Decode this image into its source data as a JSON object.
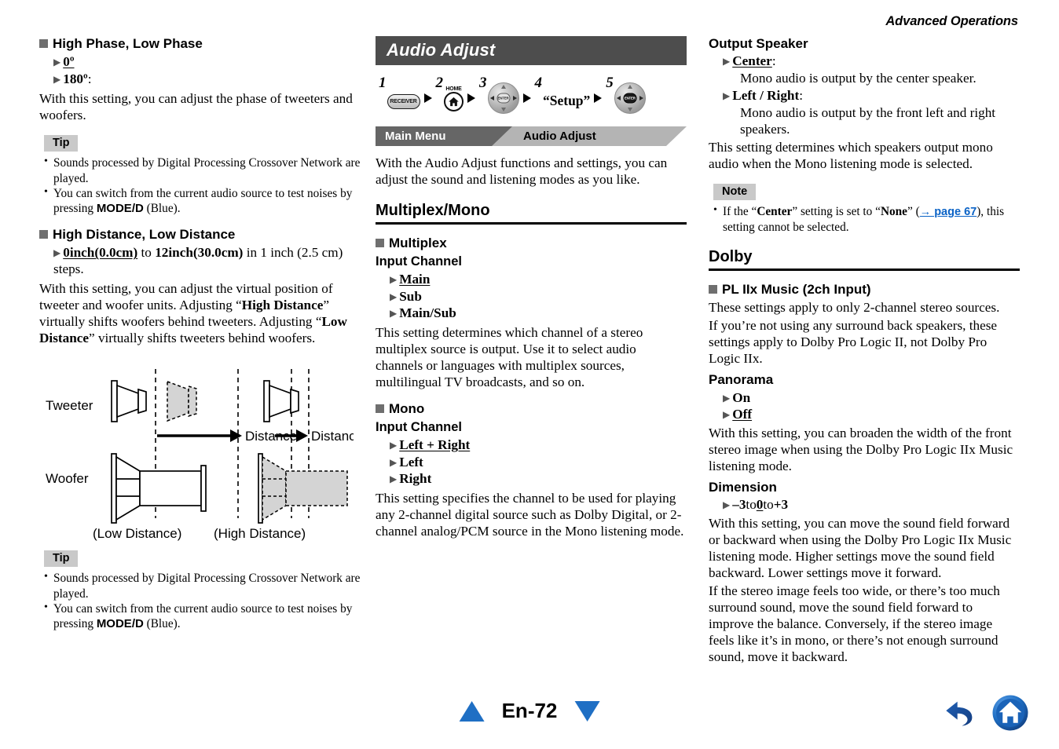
{
  "running_head": "Advanced Operations",
  "left_column": {
    "section1": {
      "heading": "High Phase, Low Phase",
      "options": [
        {
          "label": "0º",
          "underlined": true,
          "suffix": ""
        },
        {
          "label": "180º",
          "underlined": false,
          "suffix": ":"
        }
      ],
      "body": "With this setting, you can adjust the phase of tweeters and woofers.",
      "tip_label": "Tip",
      "tips": [
        "Sounds processed by Digital Processing Crossover Network are played.",
        "You can switch from the current audio source to test noises by pressing MODE/D (Blue)."
      ],
      "tip2_prefix": "You can switch from the current audio source to test noises by pressing ",
      "tip2_key": "MODE/D",
      "tip2_suffix": " (Blue)."
    },
    "section2": {
      "heading": "High Distance, Low Distance",
      "range_from": "0inch(0.0cm)",
      "range_mid": " to ",
      "range_to": "12inch(30.0cm)",
      "range_tail": " in 1 inch (2.5 cm) steps.",
      "body_1": "With this setting, you can adjust the virtual position of tweeter and woofer units. Adjusting “",
      "body_b1": "High Distance",
      "body_2": "” virtually shifts woofers behind tweeters. Adjusting “",
      "body_b2": "Low Distance",
      "body_3": "” virtually shifts tweeters behind woofers.",
      "tip_label": "Tip",
      "tip1": "Sounds processed by Digital Processing Crossover Network are played.",
      "tip2_prefix": "You can switch from the current audio source to test noises by pressing ",
      "tip2_key": "MODE/D",
      "tip2_suffix": " (Blue)."
    },
    "diagram": {
      "row_label_top": "Tweeter",
      "row_label_bottom": "Woofer",
      "distance_label_left": "Distance",
      "distance_label_right": "Distance",
      "caption_left": "(Low Distance)",
      "caption_right": "(High Distance)"
    }
  },
  "mid_column": {
    "title": "Audio Adjust",
    "steps": {
      "n1": "1",
      "btn1_label": "RECEIVER",
      "n2": "2",
      "btn2_label": "HOME",
      "btn2_icon": "home-icon",
      "n3": "3",
      "btn3_center": "ENTER",
      "n4": "4",
      "step4_text": "“Setup”",
      "n5": "5",
      "btn5_center": "ENTER"
    },
    "breadcrumb": {
      "parent": "Main Menu",
      "current": "Audio Adjust"
    },
    "intro": "With the Audio Adjust functions and settings, you can adjust the sound and listening modes as you like.",
    "section_heading": "Multiplex/Mono",
    "multiplex": {
      "heading": "Multiplex",
      "sub_head": "Input Channel",
      "options": [
        {
          "label": "Main",
          "underlined": true
        },
        {
          "label": "Sub",
          "underlined": false
        },
        {
          "label": "Main/Sub",
          "underlined": false
        }
      ],
      "body": "This setting determines which channel of a stereo multiplex source is output. Use it to select audio channels or languages with multiplex sources, multilingual TV broadcasts, and so on."
    },
    "mono": {
      "heading": "Mono",
      "sub_head": "Input Channel",
      "options": [
        {
          "label": "Left + Right",
          "underlined": true
        },
        {
          "label": "Left",
          "underlined": false
        },
        {
          "label": "Right",
          "underlined": false
        }
      ],
      "body": "This setting specifies the channel to be used for playing any 2-channel digital source such as Dolby Digital, or 2-channel analog/PCM source in the Mono listening mode."
    }
  },
  "right_column": {
    "output_speaker": {
      "sub_head": "Output Speaker",
      "options": [
        {
          "label": "Center",
          "underlined": true,
          "colon": ":",
          "desc": "Mono audio is output by the center speaker."
        },
        {
          "label": "Left / Right",
          "underlined": false,
          "colon": ":",
          "desc": "Mono audio is output by the front left and right speakers."
        }
      ],
      "body": "This setting determines which speakers output mono audio when the Mono listening mode is selected."
    },
    "note": {
      "label": "Note",
      "part1": "If the “",
      "bold1": "Center",
      "part2": "” setting is set to “",
      "bold2": "None",
      "part3": "” (",
      "link": "→ page 67",
      "part4": "), this setting cannot be selected."
    },
    "dolby": {
      "section_heading": "Dolby",
      "heading": "PL IIx Music (2ch Input)",
      "body1": "These settings apply to only 2-channel stereo sources.",
      "body2": "If you’re not using any surround back speakers, these settings apply to Dolby Pro Logic II, not Dolby Pro Logic IIx.",
      "panorama": {
        "sub_head": "Panorama",
        "options": [
          {
            "label": "On",
            "underlined": false
          },
          {
            "label": "Off",
            "underlined": true
          }
        ],
        "body": "With this setting, you can broaden the width of the front stereo image when using the Dolby Pro Logic IIx Music listening mode."
      },
      "dimension": {
        "sub_head": "Dimension",
        "range_a": "–3",
        "range_sep1": " to ",
        "range_b": "0",
        "range_sep2": " to ",
        "range_c": "+3",
        "body1": "With this setting, you can move the sound field forward or backward when using the Dolby Pro Logic IIx Music listening mode. Higher settings move the sound field backward. Lower settings move it forward.",
        "body2": "If the stereo image feels too wide, or there’s too much surround sound, move the sound field forward to improve the balance. Conversely, if the stereo image feels like it’s in mono, or there’s not enough surround sound, move it backward."
      }
    }
  },
  "footer": {
    "prev_label": "prev-page-triangle",
    "page_number": "En-72",
    "next_label": "next-page-triangle",
    "back_icon": "back-arrow-icon",
    "home_icon": "home-icon"
  },
  "colors": {
    "title_bar": "#4d4d4d",
    "crumb_dark": "#666666",
    "crumb_light": "#b4b4b4",
    "label_box": "#c9c9c9",
    "bullet_square": "#6f6f6f",
    "link_blue": "#0b63c6",
    "accent_blue": "#1f6fc4"
  }
}
